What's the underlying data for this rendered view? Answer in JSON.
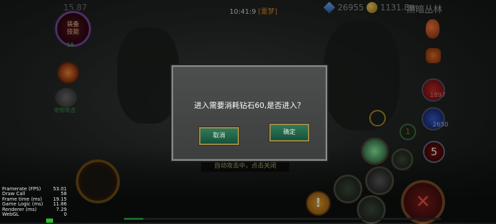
{
  "hud": {
    "fps": "15.87",
    "clock": "10:41:9",
    "mode": "[噩梦]",
    "diamonds": "26955",
    "gold": "1131.8w",
    "zone": "黑暗丛林"
  },
  "left": {
    "equip_label": "装备技能",
    "level": "58",
    "pet_label": "宠物攻击"
  },
  "right": {
    "hp_value": "1897",
    "mp_value": "2650",
    "slot_one": "1",
    "slot_five": "5",
    "warn_glyph": "!",
    "attack_glyph": "✕"
  },
  "auto_attack_text": "自动攻击中，点击关闭",
  "dialog": {
    "message": "进入需要消耗钻石60,是否进入？",
    "cancel_label": "取消",
    "confirm_label": "确定"
  },
  "stats": [
    {
      "label": "Framerate (FPS)",
      "value": "53.01"
    },
    {
      "label": "Draw Call",
      "value": "58"
    },
    {
      "label": "Frame time (ms)",
      "value": "19.15"
    },
    {
      "label": "Game Logic (ms)",
      "value": "11.86"
    },
    {
      "label": "Renderer (ms)",
      "value": "7.29"
    },
    {
      "label": "WebGL",
      "value": "0"
    }
  ],
  "colors": {
    "dialog_bg": "#4d4f4e",
    "button_green": "#2f7a5a",
    "button_border": "#a08a4a",
    "mode_orange": "#e08a2a"
  }
}
